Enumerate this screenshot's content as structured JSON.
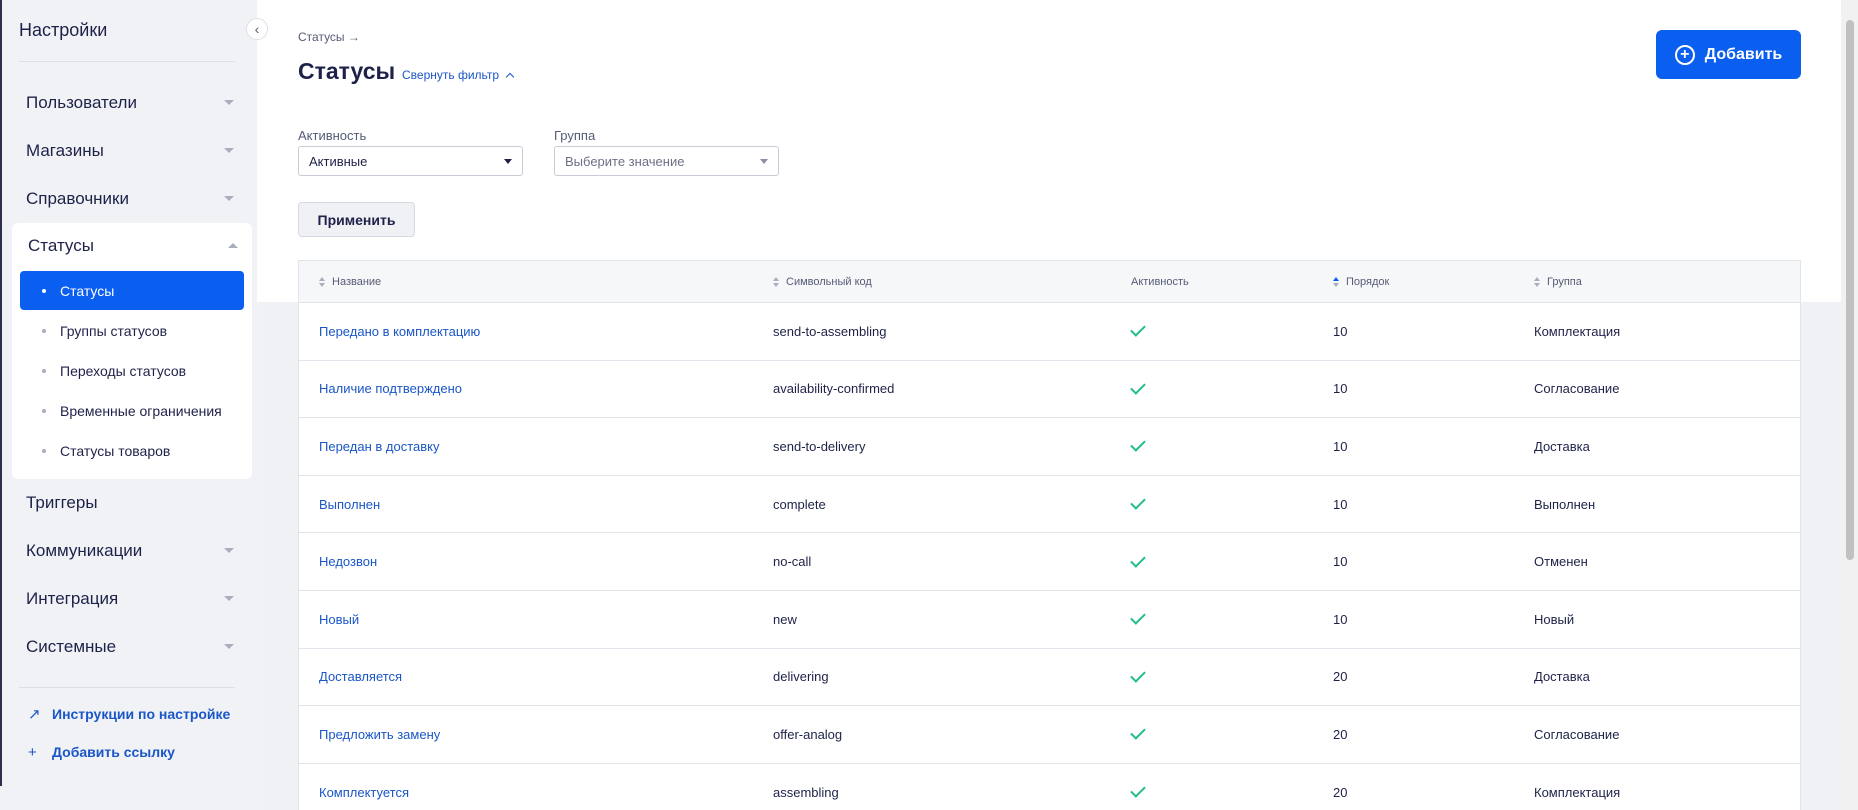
{
  "sidebar": {
    "title": "Настройки",
    "items_top": [
      {
        "label": "Пользователи"
      },
      {
        "label": "Магазины"
      },
      {
        "label": "Справочники"
      }
    ],
    "expanded_group": {
      "label": "Статусы",
      "subitems": [
        {
          "label": "Статусы",
          "active": true
        },
        {
          "label": "Группы статусов"
        },
        {
          "label": "Переходы статусов"
        },
        {
          "label": "Временные ограничения"
        },
        {
          "label": "Статусы товаров"
        }
      ]
    },
    "items_bottom": [
      {
        "label": "Триггеры"
      },
      {
        "label": "Коммуникации"
      },
      {
        "label": "Интеграция"
      },
      {
        "label": "Системные"
      }
    ],
    "links": [
      {
        "label": "Инструкции по настройке",
        "icon": "arrow-up-right-icon"
      },
      {
        "label": "Добавить ссылку",
        "icon": "plus-icon"
      }
    ]
  },
  "header": {
    "breadcrumb": "Статусы →",
    "title": "Статусы",
    "collapse_filter": "Свернуть фильтр",
    "add_button": "Добавить"
  },
  "filters": {
    "activity": {
      "label": "Активность",
      "value": "Активные"
    },
    "group": {
      "label": "Группа",
      "placeholder": "Выберите значение"
    },
    "apply": "Применить"
  },
  "table": {
    "columns": [
      "Название",
      "Символьный код",
      "Активность",
      "Порядок",
      "Группа"
    ],
    "rows": [
      {
        "name": "Передано в комплектацию",
        "code": "send-to-assembling",
        "active": true,
        "order": "10",
        "group": "Комплектация"
      },
      {
        "name": "Наличие подтверждено",
        "code": "availability-confirmed",
        "active": true,
        "order": "10",
        "group": "Согласование"
      },
      {
        "name": "Передан в доставку",
        "code": "send-to-delivery",
        "active": true,
        "order": "10",
        "group": "Доставка"
      },
      {
        "name": "Выполнен",
        "code": "complete",
        "active": true,
        "order": "10",
        "group": "Выполнен"
      },
      {
        "name": "Недозвон",
        "code": "no-call",
        "active": true,
        "order": "10",
        "group": "Отменен"
      },
      {
        "name": "Новый",
        "code": "new",
        "active": true,
        "order": "10",
        "group": "Новый"
      },
      {
        "name": "Доставляется",
        "code": "delivering",
        "active": true,
        "order": "20",
        "group": "Доставка"
      },
      {
        "name": "Предложить замену",
        "code": "offer-analog",
        "active": true,
        "order": "20",
        "group": "Согласование"
      },
      {
        "name": "Комплектуется",
        "code": "assembling",
        "active": true,
        "order": "20",
        "group": "Комплектация"
      }
    ]
  },
  "colors": {
    "accent": "#0a5ef0",
    "link": "#1a56c7",
    "check": "#1fbf84"
  }
}
